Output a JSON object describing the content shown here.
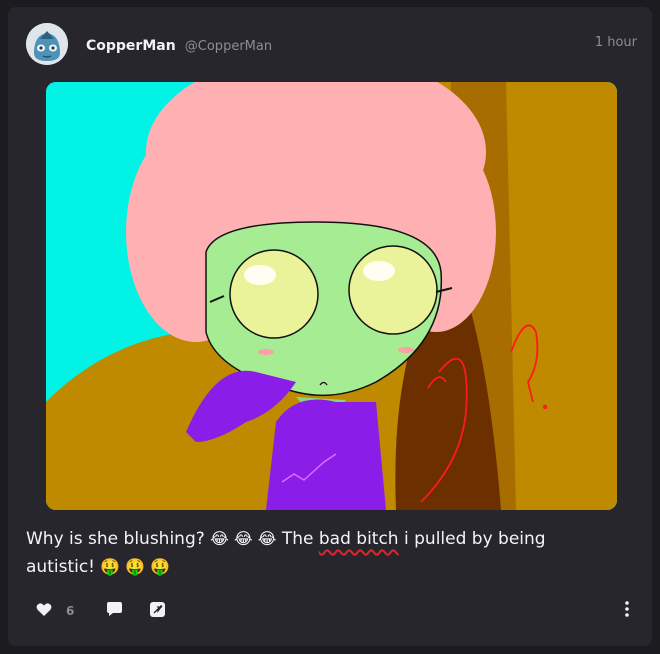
{
  "post": {
    "author_name": "CopperMan",
    "author_handle": "@CopperMan",
    "time": "1 hour",
    "text": {
      "part1": "Why is she blushing?",
      "part2": "The",
      "underlined": "bad bitch",
      "part3": "i pulled by being autistic!"
    },
    "emoji_a": "😂 😂 😂",
    "emoji_b": "🤑 🤑 🤑",
    "like_count": "6"
  },
  "icons": {
    "avatar": "avatar",
    "like": "heart-icon",
    "reply": "speech-bubble-icon",
    "share": "share-icon",
    "more": "more-vertical-icon"
  },
  "colors": {
    "card_bg": "#27262c",
    "page_bg": "#1c1b20",
    "muted_text": "#8d8c94",
    "underline": "#e0262a"
  }
}
